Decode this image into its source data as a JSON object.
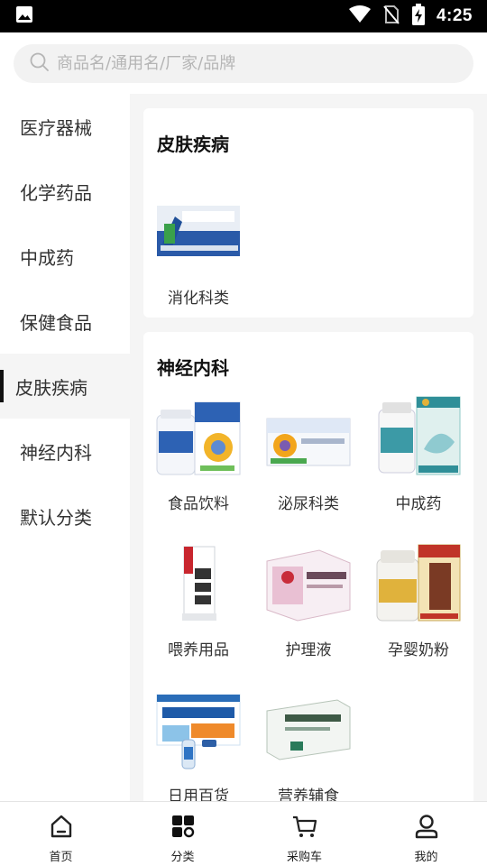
{
  "status_bar": {
    "time": "4:25",
    "icons": [
      "image-icon",
      "wifi-icon",
      "no-sim-icon",
      "battery-charging-icon"
    ]
  },
  "search": {
    "placeholder": "商品名/通用名/厂家/品牌",
    "value": ""
  },
  "sidebar": {
    "items": [
      {
        "label": "医疗器械",
        "active": false
      },
      {
        "label": "化学药品",
        "active": false
      },
      {
        "label": "中成药",
        "active": false
      },
      {
        "label": "保健食品",
        "active": false
      },
      {
        "label": "皮肤疾病",
        "active": true
      },
      {
        "label": "神经内科",
        "active": false
      },
      {
        "label": "默认分类",
        "active": false
      }
    ]
  },
  "sections": [
    {
      "title": "皮肤疾病",
      "items": [
        {
          "label": "消化科类",
          "image": "oral-liquid-box-image"
        }
      ]
    },
    {
      "title": "神经内科",
      "items": [
        {
          "label": "食品饮料",
          "image": "hugan-tablet-bottle-image"
        },
        {
          "label": "泌尿科类",
          "image": "weikangling-capsule-box-image"
        },
        {
          "label": "中成药",
          "image": "jinkui-shenqi-pill-image"
        },
        {
          "label": "喂养用品",
          "image": "qiguan-yan-pill-box-image"
        },
        {
          "label": "护理液",
          "image": "jiawei-xiaoyao-pill-box-image"
        },
        {
          "label": "孕婴奶粉",
          "image": "pifu-bingxue-pill-image"
        },
        {
          "label": "日用百货",
          "image": "children-cough-oral-liquid-image"
        },
        {
          "label": "营养辅食",
          "image": "yunnan-baiyao-plaster-image"
        }
      ]
    }
  ],
  "tabbar": {
    "tabs": [
      {
        "label": "首页",
        "icon": "home-icon",
        "active": false
      },
      {
        "label": "分类",
        "icon": "category-icon",
        "active": true
      },
      {
        "label": "采购车",
        "icon": "cart-icon",
        "active": false
      },
      {
        "label": "我的",
        "icon": "profile-icon",
        "active": false
      }
    ]
  },
  "colors": {
    "accent": "#111111",
    "background": "#f5f5f5",
    "card": "#ffffff",
    "placeholder": "#b5b5b5"
  }
}
